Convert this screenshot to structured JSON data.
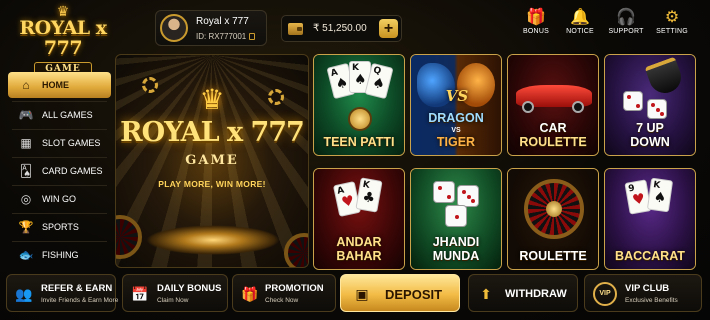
{
  "logo": {
    "brand": "ROYAL x 777",
    "sub": "GAME"
  },
  "profile": {
    "username": "Royal x 777",
    "user_id": "ID: RX777001"
  },
  "balance": {
    "amount": "₹ 51,250.00",
    "add_label": "+"
  },
  "top_actions": [
    {
      "label": "BONUS",
      "icon": "gift-icon"
    },
    {
      "label": "NOTICE",
      "icon": "bell-icon"
    },
    {
      "label": "SUPPORT",
      "icon": "headset-icon"
    },
    {
      "label": "SETTING",
      "icon": "gear-icon"
    }
  ],
  "sidebar": {
    "items": [
      {
        "label": "HOME",
        "icon": "home-icon",
        "active": true
      },
      {
        "label": "ALL GAMES",
        "icon": "gamepad-icon"
      },
      {
        "label": "SLOT GAMES",
        "icon": "slot-machine-icon"
      },
      {
        "label": "CARD GAMES",
        "icon": "cards-icon"
      },
      {
        "label": "WIN GO",
        "icon": "target-icon"
      },
      {
        "label": "SPORTS",
        "icon": "trophy-icon"
      },
      {
        "label": "FISHING",
        "icon": "fish-icon"
      }
    ]
  },
  "hero": {
    "brand": "ROYAL x 777",
    "sub": "GAME",
    "tagline": "PLAY MORE, WIN MORE!"
  },
  "games": [
    {
      "name": "TEEN PATTI"
    },
    {
      "name_top": "DRAGON",
      "name_vs": "VS",
      "name_bottom": "TIGER",
      "badge": "VS"
    },
    {
      "name_top": "CAR",
      "name_bottom": "ROULETTE"
    },
    {
      "name_top": "7 UP",
      "name_bottom": "DOWN"
    },
    {
      "name_top": "ANDAR",
      "name_bottom": "BAHAR"
    },
    {
      "name_top": "JHANDI",
      "name_bottom": "MUNDA"
    },
    {
      "name": "ROULETTE"
    },
    {
      "name": "BACCARAT"
    }
  ],
  "bottom_bar": {
    "refer": {
      "title": "REFER & EARN",
      "sub": "Invite Friends & Earn More"
    },
    "daily": {
      "title": "DAILY BONUS",
      "sub": "Claim Now"
    },
    "promo": {
      "title": "PROMOTION",
      "sub": "Check Now"
    },
    "deposit": {
      "title": "DEPOSIT"
    },
    "withdraw": {
      "title": "WITHDRAW"
    },
    "vip": {
      "title": "VIP CLUB",
      "sub": "Exclusive Benefits",
      "badge": "VIP"
    }
  },
  "colors": {
    "gold": "#f0bc3a",
    "gold_light": "#ffe08a",
    "background": "#0a0a0a"
  }
}
